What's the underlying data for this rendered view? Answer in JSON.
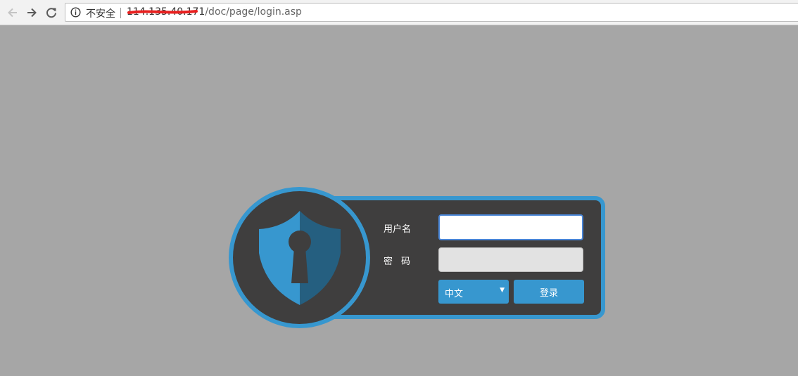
{
  "browser": {
    "security_label": "不安全",
    "url_host": "114.135.40.171",
    "url_path": "/doc/page/login.asp"
  },
  "login": {
    "username_label": "用户名",
    "password_label": "密码",
    "username_value": "",
    "password_value": "",
    "language_selected": "中文",
    "login_button": "登录"
  },
  "colors": {
    "background": "#a6a6a6",
    "panel": "#3f3e3e",
    "accent": "#3797cf"
  }
}
